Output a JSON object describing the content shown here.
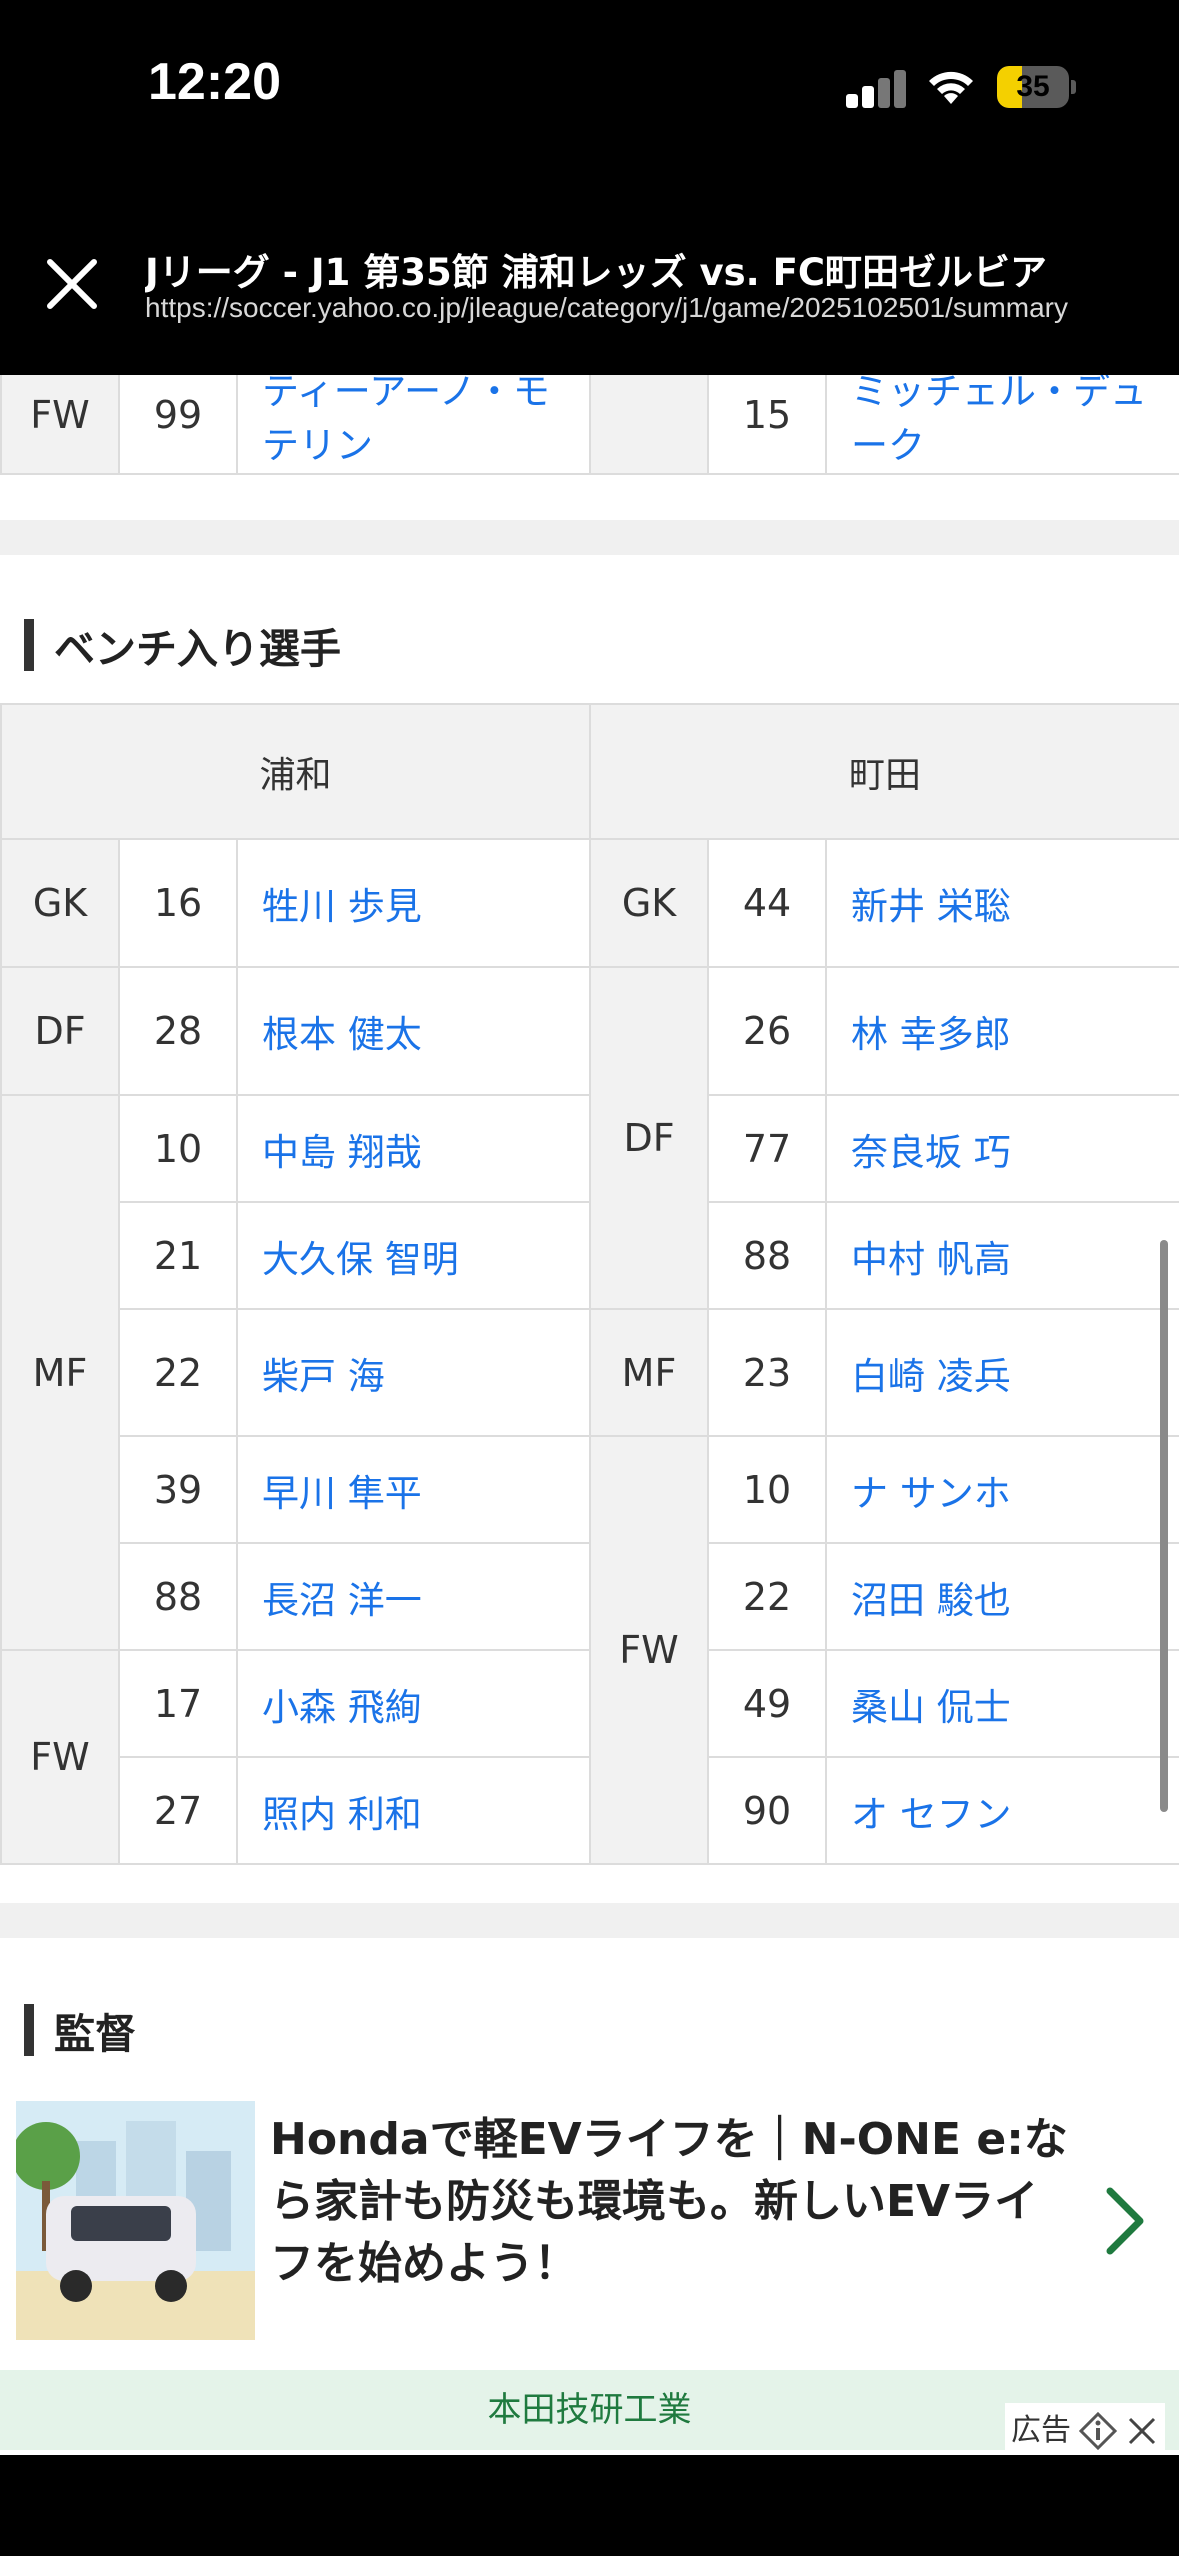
{
  "status_bar": {
    "time": "12:20",
    "battery": "35",
    "battery_level": 0.35
  },
  "browser": {
    "title": "Jリーグ - J1 第35節 浦和レッズ vs. FC町田ゼルビア",
    "url": "https://soccer.yahoo.co.jp/jleague/category/j1/game/2025102501/summary"
  },
  "starting_tail": {
    "left": {
      "pos": "FW",
      "num": "99",
      "name": "ティーアーノ・モ テリン"
    },
    "right": {
      "num": "15",
      "name": "ミッチェル・デュ ーク"
    }
  },
  "bench": {
    "heading": "ベンチ入り選手",
    "left_team": "浦和",
    "right_team": "町田",
    "rows": [
      {
        "lpos": "GK",
        "lnum": "16",
        "lname": "牲川 歩見",
        "rpos": "GK",
        "rnum": "44",
        "rname": "新井 栄聡"
      },
      {
        "lpos": "DF",
        "lnum": "28",
        "lname": "根本 健太",
        "rpos": "DF",
        "rnum": "26",
        "rname": "林 幸多郎"
      },
      {
        "lpos": "MF",
        "lnum": "10",
        "lname": "中島 翔哉",
        "rnum": "77",
        "rname": "奈良坂 巧"
      },
      {
        "lnum": "21",
        "lname": "大久保 智明",
        "rnum": "88",
        "rname": "中村 帆高"
      },
      {
        "lnum": "22",
        "lname": "柴戸 海",
        "rpos": "MF",
        "rnum": "23",
        "rname": "白崎 凌兵"
      },
      {
        "lnum": "39",
        "lname": "早川 隼平",
        "rpos": "FW",
        "rnum": "10",
        "rname": "ナ サンホ"
      },
      {
        "lnum": "88",
        "lname": "長沼 洋一",
        "rnum": "22",
        "rname": "沼田 駿也"
      },
      {
        "lpos": "FW",
        "lnum": "17",
        "lname": "小森 飛絢",
        "rnum": "49",
        "rname": "桑山 侃士"
      },
      {
        "lnum": "27",
        "lname": "照内 利和",
        "rnum": "90",
        "rname": "オ セフン"
      }
    ]
  },
  "manager": {
    "heading": "監督"
  },
  "ad": {
    "text": "Hondaで軽EVライフを｜N-ONE e:なら家計も防災も環境も。新しいEVライフを始めよう！",
    "sponsor": "本田技研工業",
    "label": "広告"
  }
}
